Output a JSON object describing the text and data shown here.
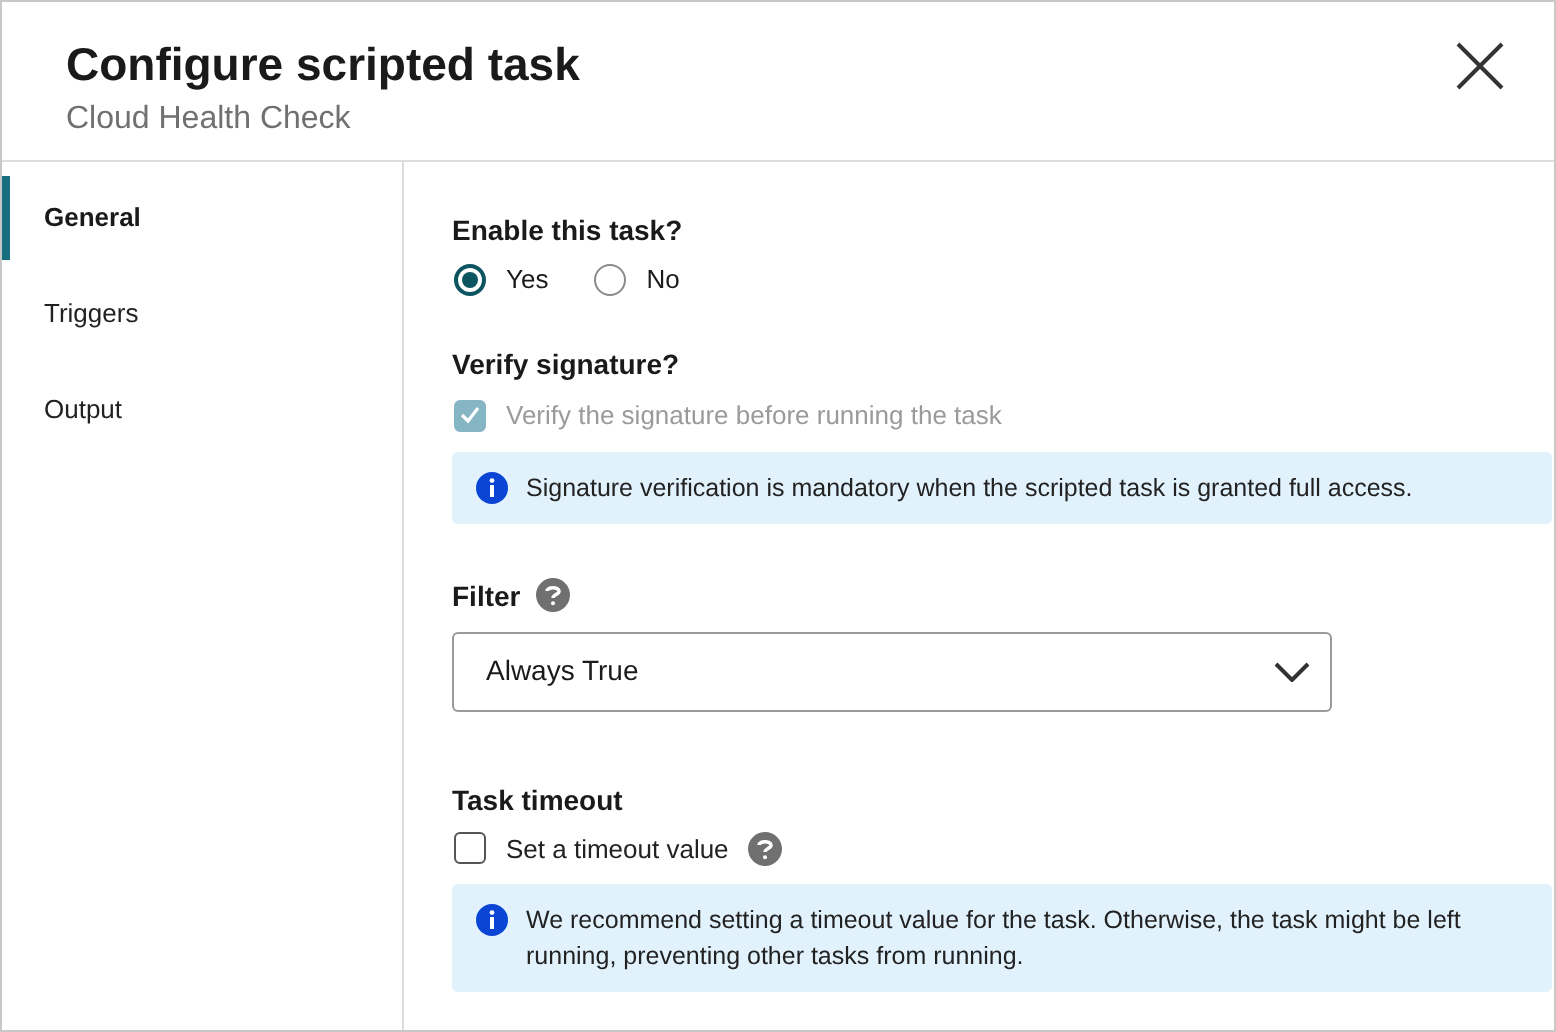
{
  "dialog": {
    "title": "Configure scripted task",
    "subtitle": "Cloud Health Check"
  },
  "sidebar": {
    "items": [
      {
        "label": "General",
        "selected": true
      },
      {
        "label": "Triggers",
        "selected": false
      },
      {
        "label": "Output",
        "selected": false
      }
    ]
  },
  "enable": {
    "label": "Enable this task?",
    "options": [
      {
        "label": "Yes",
        "selected": true
      },
      {
        "label": "No",
        "selected": false
      }
    ]
  },
  "verify": {
    "label": "Verify signature?",
    "checkbox": {
      "label": "Verify the signature before running the task",
      "checked": true,
      "disabled": true
    },
    "info": "Signature verification is mandatory when the scripted task is granted full access."
  },
  "filter": {
    "label": "Filter",
    "value": "Always True"
  },
  "timeout": {
    "label": "Task timeout",
    "checkbox": {
      "label": "Set a timeout value",
      "checked": false,
      "disabled": false
    },
    "info": "We recommend setting a timeout value for the task. Otherwise, the task might be left running, preventing other tasks from running."
  }
}
